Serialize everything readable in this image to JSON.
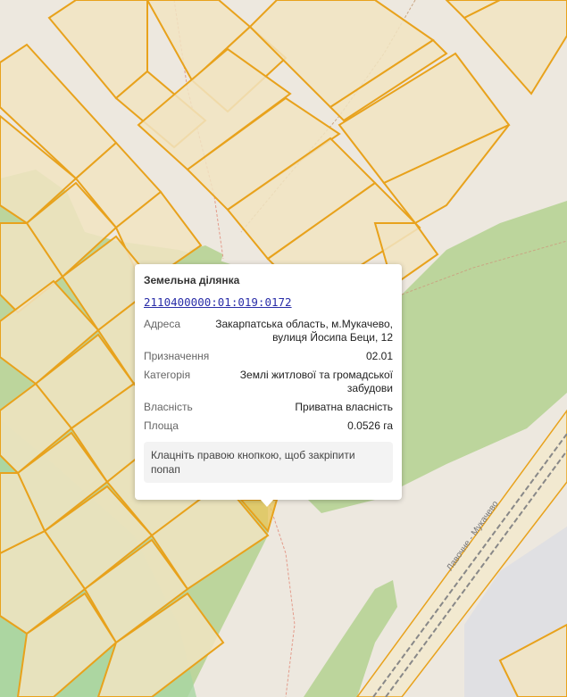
{
  "map": {
    "rail_label": "Лавочне - Мукачево",
    "colors": {
      "background": "#ede8df",
      "parcel_fill": "#f1e4c2",
      "parcel_border": "#e8a21c",
      "forest": "#bcd59c",
      "forest_on_parcel": "#c8d4a0",
      "meadow": "#a8d6a2",
      "road": "#f2e9d0",
      "industrial": "#e0e0e3"
    }
  },
  "popup": {
    "title": "Земельна ділянка",
    "cadastral_number": "2110400000:01:019:0172",
    "rows": [
      {
        "label": "Адреса",
        "value": "Закарпатська область, м.Мукачево, вулиця Йосипа Беци, 12"
      },
      {
        "label": "Призначення",
        "value": "02.01"
      },
      {
        "label": "Категорія",
        "value": "Землі житлової та громадської забудови"
      },
      {
        "label": "Власність",
        "value": "Приватна власність"
      },
      {
        "label": "Площа",
        "value": "0.0526 га"
      }
    ],
    "hint": "Клацніть правою кнопкою, щоб закріпити попап"
  }
}
